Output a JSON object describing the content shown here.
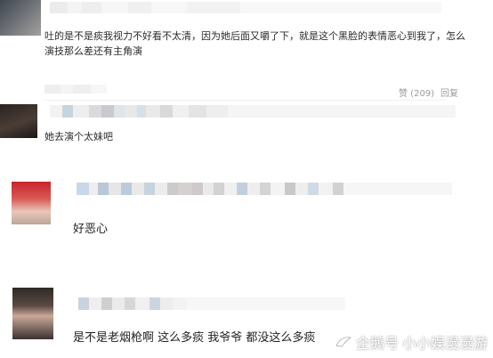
{
  "comments": [
    {
      "text_line1": "吐的是不是痰我视力不好看不太清，因为她后面又嚼了下，就是这个黑脸的表情恶心到我了，怎么",
      "text_line2": "演技那么差还有主角演",
      "likes": "赞 (209)",
      "reply": "回复"
    },
    {
      "text": "她去演个太妹吧"
    },
    {
      "text": "好恶心"
    },
    {
      "text": "是不是老烟枪啊 这么多痰 我爷爷 都没这么多痰"
    }
  ],
  "watermark": {
    "platform": "企鹅号",
    "account": "小小娱漫漫游"
  },
  "colors": {
    "accent_blur_blue": "#c9d8e8",
    "blur_gray": "#d8d8d8",
    "text": "#2b2b2b",
    "meta": "#9a9a9a"
  }
}
